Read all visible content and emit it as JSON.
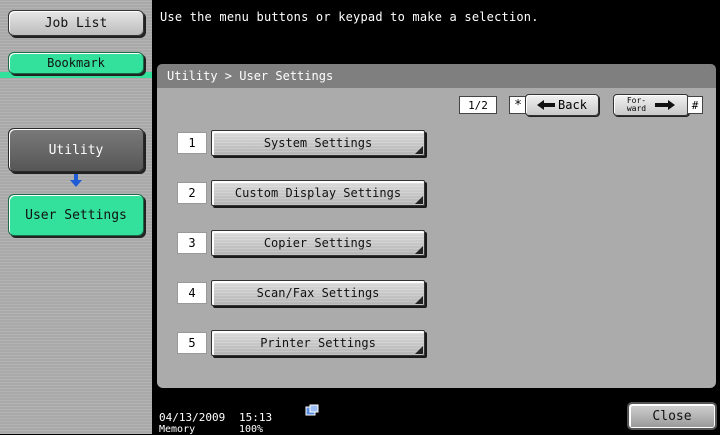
{
  "sidebar": {
    "job_list_label": "Job List",
    "bookmark_label": "Bookmark",
    "utility_label": "Utility",
    "user_settings_label": "User Settings"
  },
  "message": "Use the menu buttons or keypad to make a selection.",
  "panel": {
    "title": "Utility > User Settings",
    "page_indicator": "1/2",
    "star_key": "*",
    "back_label": "Back",
    "forward_label_top": "For-",
    "forward_label_bottom": "ward",
    "hash_key": "#"
  },
  "menu": {
    "items": [
      {
        "number": "1",
        "label": "System Settings"
      },
      {
        "number": "2",
        "label": "Custom Display Settings"
      },
      {
        "number": "3",
        "label": "Copier Settings"
      },
      {
        "number": "4",
        "label": "Scan/Fax Settings"
      },
      {
        "number": "5",
        "label": "Printer Settings"
      }
    ]
  },
  "footer": {
    "date": "04/13/2009",
    "time": "15:13",
    "memory_label": "Memory",
    "memory_value": "100%",
    "close_label": "Close"
  },
  "colors": {
    "accent_green": "#33e19c",
    "panel_gray": "#ababab",
    "arrow_blue": "#1e5bd6"
  },
  "icons": {
    "utility_arrow": "arrow-down-icon",
    "back_arrow": "arrow-left-icon",
    "forward_arrow": "arrow-right-icon",
    "network": "network-status-icon"
  }
}
